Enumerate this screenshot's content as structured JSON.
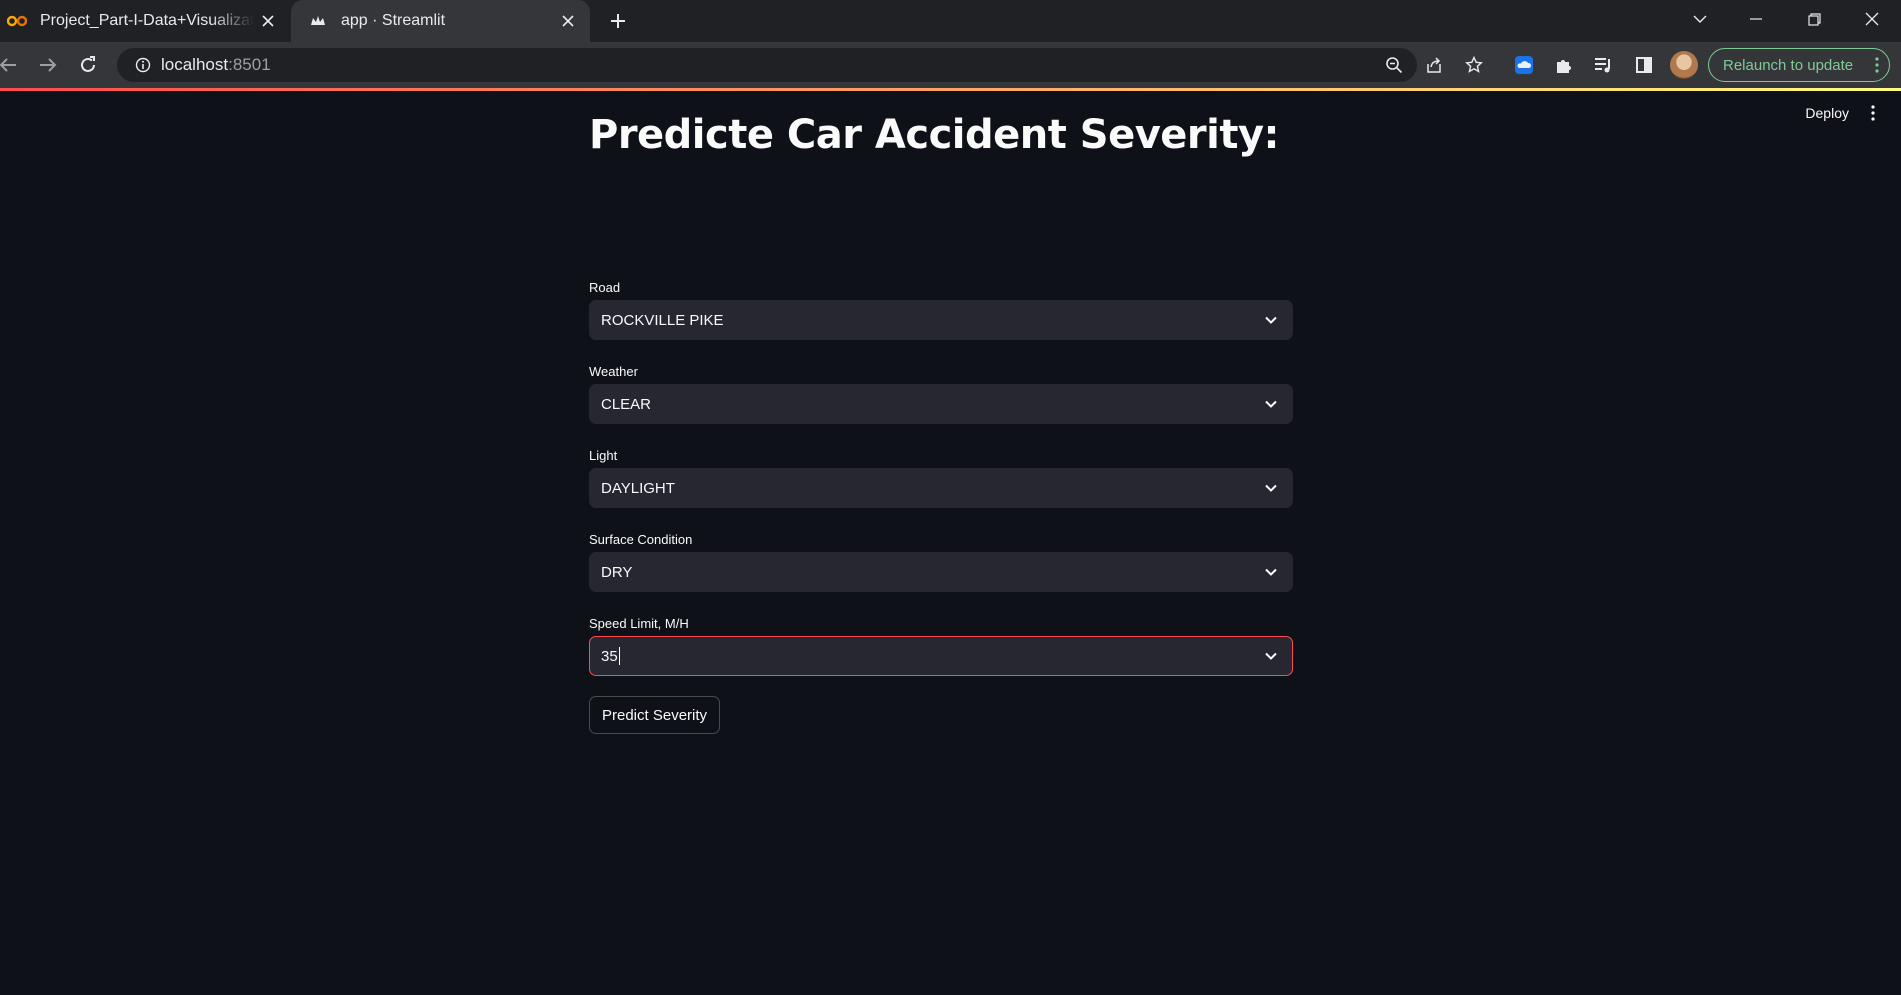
{
  "browser": {
    "tabs": [
      {
        "title": "Project_Part-I-Data+Visualization",
        "active": false
      },
      {
        "title": "app · Streamlit",
        "active": true
      }
    ],
    "url_host": "localhost",
    "url_port": ":8501",
    "relaunch_label": "Relaunch to update"
  },
  "app": {
    "deploy_label": "Deploy",
    "title": "Predicte Car Accident Severity:",
    "fields": [
      {
        "label": "Road",
        "value": "ROCKVILLE PIKE"
      },
      {
        "label": "Weather",
        "value": "CLEAR"
      },
      {
        "label": "Light",
        "value": "DAYLIGHT"
      },
      {
        "label": "Surface Condition",
        "value": "DRY"
      },
      {
        "label": "Speed Limit, M/H",
        "value": "35"
      }
    ],
    "predict_button": "Predict Severity"
  },
  "colors": {
    "background": "#0e1117",
    "input_bg": "#262730",
    "focus_border": "#ff4b4b",
    "relaunch_green": "#81c995"
  }
}
